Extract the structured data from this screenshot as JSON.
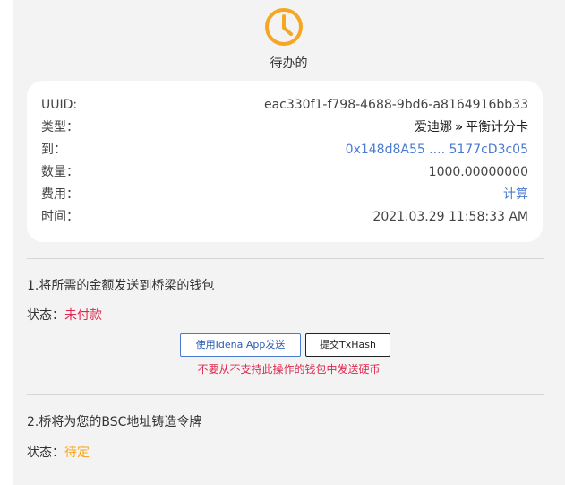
{
  "status": {
    "label": "待办的",
    "icon": "clock-icon",
    "icon_color": "#f5a623"
  },
  "details": {
    "uuid_label": "UUID:",
    "uuid_value": "eac330f1-f798-4688-9bd6-a8164916bb33",
    "type_label": "类型：",
    "type_from": "爱迪娜",
    "type_separator": "»",
    "type_to": "平衡计分卡",
    "to_label": "到：",
    "to_value": "0x148d8A55 .... 5177cD3c05",
    "amount_label": "数量：",
    "amount_value": "1000.00000000",
    "fee_label": "费用：",
    "fee_value": "计算",
    "time_label": "时间：",
    "time_value": "2021.03.29 11:58:33 AM"
  },
  "step1": {
    "title": "1.将所需的金额发送到桥梁的钱包",
    "state_label": "状态：",
    "state_value": "未付款",
    "send_button": "使用Idena App发送",
    "submit_button": "提交TxHash",
    "warning": "不要从不支持此操作的钱包中发送硬币"
  },
  "step2": {
    "title": "2.桥将为您的BSC地址铸造令牌",
    "state_label": "状态：",
    "state_value": "待定"
  },
  "colors": {
    "accent_blue": "#4a7bd0",
    "error_red": "#e0284f",
    "pending_orange": "#f5a623"
  }
}
